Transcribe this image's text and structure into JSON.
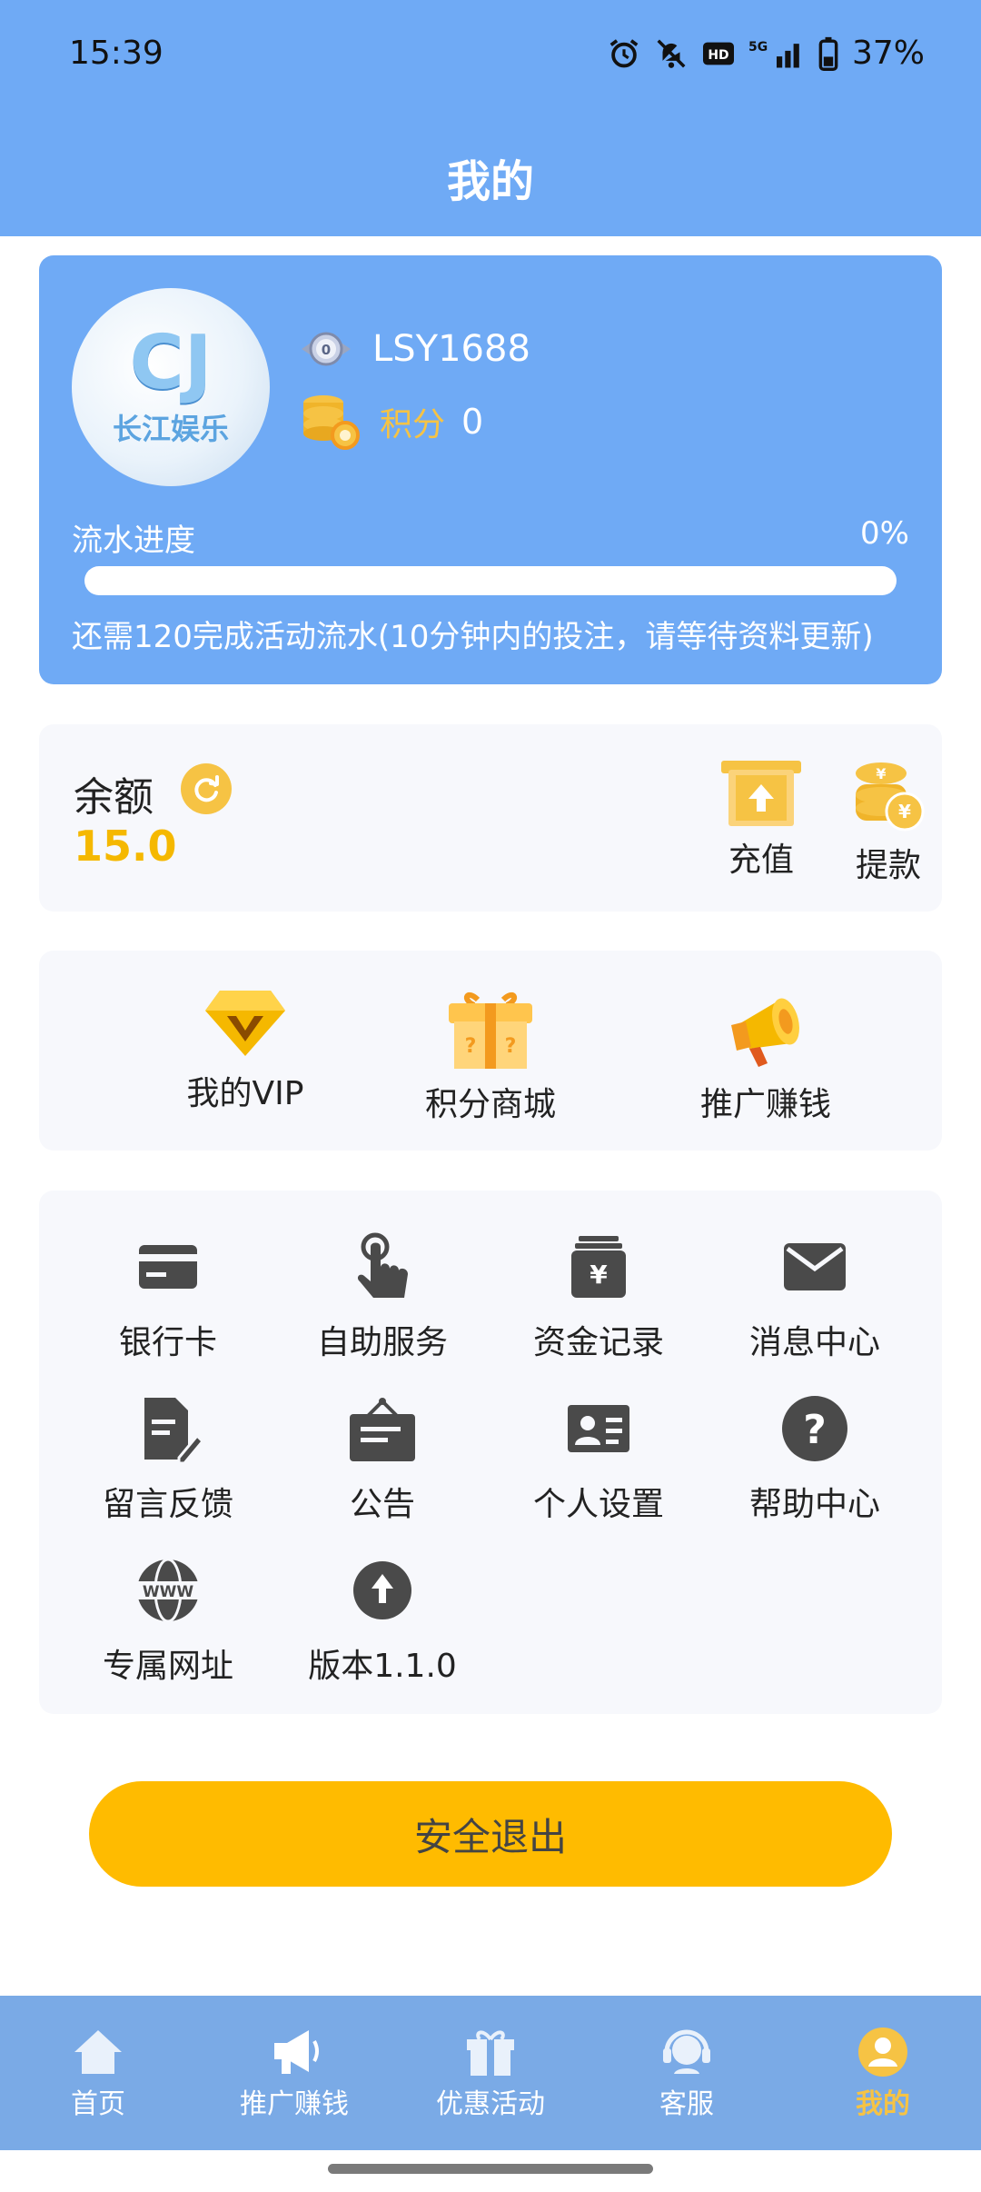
{
  "status_bar": {
    "time": "15:39",
    "battery": "37%",
    "icons": [
      "alarm-icon",
      "bell-off-icon",
      "hd-icon",
      "signal-5g-icon",
      "battery-icon"
    ]
  },
  "header": {
    "title": "我的"
  },
  "profile": {
    "logo_mark": "CJ",
    "logo_text": "长江娱乐",
    "username": "LSY1688",
    "points_label": "积分",
    "points_value": "0",
    "flow_label": "流水进度",
    "flow_percent": "0%",
    "flow_progress": 0,
    "flow_note": "还需120完成活动流水(10分钟内的投注，请等待资料更新)"
  },
  "balance": {
    "label": "余额",
    "value": "15.0",
    "recharge_label": "充值",
    "withdraw_label": "提款"
  },
  "features": [
    {
      "label": "我的VIP",
      "icon": "diamond-vip-icon"
    },
    {
      "label": "积分商城",
      "icon": "gift-box-icon"
    },
    {
      "label": "推广赚钱",
      "icon": "megaphone-icon"
    }
  ],
  "menu": [
    {
      "label": "银行卡",
      "icon": "bank-card-icon"
    },
    {
      "label": "自助服务",
      "icon": "hand-tap-icon"
    },
    {
      "label": "资金记录",
      "icon": "fund-record-icon"
    },
    {
      "label": "消息中心",
      "icon": "mail-icon"
    },
    {
      "label": "留言反馈",
      "icon": "feedback-icon"
    },
    {
      "label": "公告",
      "icon": "notice-board-icon"
    },
    {
      "label": "个人设置",
      "icon": "id-card-icon"
    },
    {
      "label": "帮助中心",
      "icon": "help-icon"
    },
    {
      "label": "专属网址",
      "icon": "www-icon"
    },
    {
      "label": "版本1.1.0",
      "icon": "upload-icon"
    }
  ],
  "logout_label": "安全退出",
  "nav": [
    {
      "label": "首页",
      "icon": "home-icon"
    },
    {
      "label": "推广赚钱",
      "icon": "megaphone-icon"
    },
    {
      "label": "优惠活动",
      "icon": "gift-icon"
    },
    {
      "label": "客服",
      "icon": "headset-icon"
    },
    {
      "label": "我的",
      "icon": "user-icon",
      "active": true
    }
  ],
  "colors": {
    "header_blue": "#6faaf5",
    "accent_yellow": "#ffbb00",
    "balance_yellow": "#f5b800",
    "nav_blue": "#7aaae6"
  }
}
